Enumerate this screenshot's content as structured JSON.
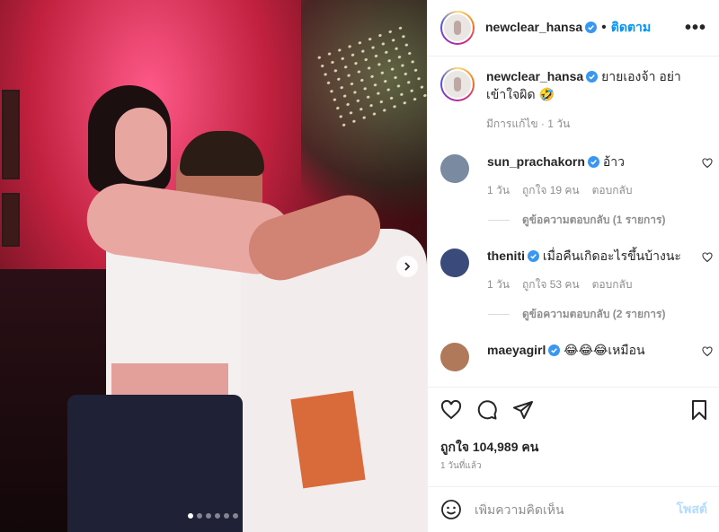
{
  "post": {
    "photo_alt": "",
    "carousel": {
      "total": 6,
      "active": 1
    }
  },
  "header": {
    "username": "newclear_hansa",
    "separator": "•",
    "follow_label": "ติดตาม",
    "more_label": "•••"
  },
  "caption": {
    "username": "newclear_hansa",
    "text": "ยายเองจ้า อย่าเข้าใจผิด 🤣",
    "meta": "มีการแก้ไข · 1 วัน"
  },
  "comments": [
    {
      "username": "sun_prachakorn",
      "text": "อ้าว",
      "age": "1 วัน",
      "likes": "ถูกใจ 19 คน",
      "reply": "ตอบกลับ",
      "view_replies": "ดูข้อความตอบกลับ (1 รายการ)",
      "avatar_color": "#7a8aa0"
    },
    {
      "username": "theniti",
      "text": "เมื่อคืนเกิดอะไรขึ้นบ้างนะ",
      "age": "1 วัน",
      "likes": "ถูกใจ 53 คน",
      "reply": "ตอบกลับ",
      "view_replies": "ดูข้อความตอบกลับ (2 รายการ)",
      "avatar_color": "#3a4a7a"
    },
    {
      "username": "maeyagirl",
      "text": "😂😂😂เหมือน",
      "avatar_color": "#b07a5a"
    }
  ],
  "stats": {
    "likes": "ถูกใจ 104,989 คน",
    "posted": "1 วันที่แล้ว"
  },
  "composer": {
    "placeholder": "เพิ่มความคิดเห็น",
    "post_label": "โพสต์"
  },
  "icons": [
    "avatar",
    "verified-badge-icon",
    "more-icon",
    "heart-icon",
    "comment-icon",
    "share-icon",
    "bookmark-icon",
    "emoji-icon",
    "chevron-right-icon"
  ],
  "colors": {
    "accent": "#0095f6",
    "verified": "#3897f0",
    "muted": "#8e8e8e",
    "post_disabled": "#b3dbff"
  }
}
